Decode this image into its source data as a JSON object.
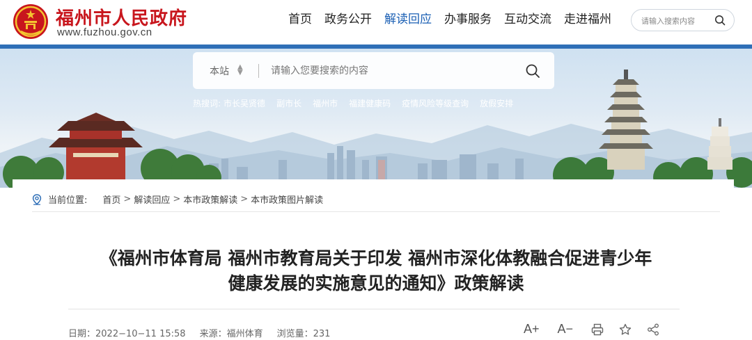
{
  "header": {
    "site_name": "福州市人民政府",
    "site_url": "www.fuzhou.gov.cn",
    "nav": [
      "首页",
      "政务公开",
      "解读回应",
      "办事服务",
      "互动交流",
      "走进福州"
    ],
    "active_nav": "解读回应",
    "search_placeholder": "请输入搜索内容"
  },
  "banner": {
    "scope": "本站",
    "search_placeholder": "请输入您要搜索的内容",
    "hot_label": "热搜词:",
    "hot_items": [
      "市长吴贤德",
      "副市长",
      "福州市",
      "福建健康码",
      "疫情风险等级查询",
      "放假安排"
    ]
  },
  "breadcrumb": {
    "prefix": "当前位置:",
    "items": [
      "首页",
      "解读回应",
      "本市政策解读",
      "本市政策图片解读"
    ],
    "separator": ">"
  },
  "article": {
    "title_line1": "《福州市体育局 福州市教育局关于印发 福州市深化体教融合促进青少年",
    "title_line2": "健康发展的实施意见的通知》政策解读",
    "date": "日期：2022−10−11 15:58",
    "source": "来源：福州体育",
    "views": "浏览量：231"
  },
  "tools": {
    "font_up": "A+",
    "font_down": "A−"
  },
  "colors": {
    "brand_red": "#c8161d",
    "accent_blue": "#2f6fb7",
    "nav_active": "#1a5fb4"
  }
}
